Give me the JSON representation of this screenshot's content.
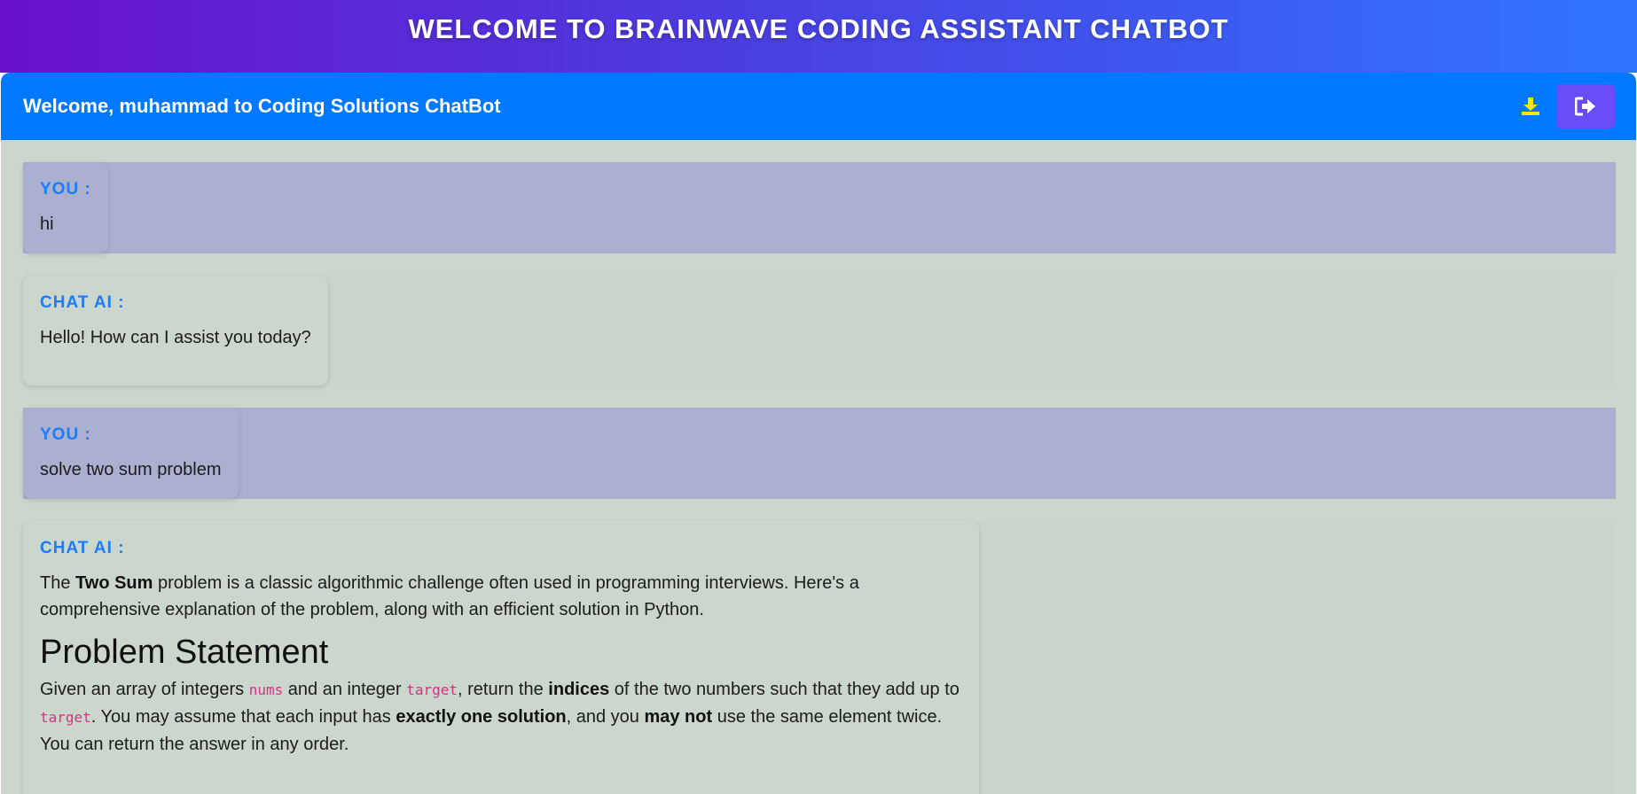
{
  "banner": {
    "title": "WELCOME TO BRAINWAVE CODING ASSISTANT CHATBOT"
  },
  "header": {
    "title": "Welcome, muhammad to Coding Solutions ChatBot",
    "download_icon": "download-icon",
    "logout_icon": "sign-out-icon"
  },
  "colors": {
    "banner_gradient_start": "#6a11cb",
    "banner_gradient_end": "#2f75ff",
    "header_bg": "#0078ff",
    "panel_bg": "#cbd6cc",
    "user_row_bg": "#abafd0",
    "sender_label": "#1a7cff",
    "logout_button": "#6a4cf6",
    "download_icon": "#ffe600",
    "code_text": "#d63384"
  },
  "messages": [
    {
      "sender": "YOU :",
      "text": "hi"
    },
    {
      "sender": "CHAT AI :",
      "text": "Hello! How can I assist you today?"
    },
    {
      "sender": "YOU :",
      "text": "solve two sum problem"
    },
    {
      "sender": "CHAT AI :",
      "intro": {
        "t1": "The ",
        "b1": "Two Sum",
        "t2": " problem is a classic algorithmic challenge often used in programming interviews. Here's a comprehensive explanation of the problem, along with an efficient solution in Python."
      },
      "heading": "Problem Statement",
      "statement": {
        "t1": "Given an array of integers ",
        "c1": "nums",
        "t2": " and an integer ",
        "c2": "target",
        "t3": ", return the ",
        "b1": "indices",
        "t4": " of the two numbers such that they add up to ",
        "c3": "target",
        "t5": ". You may assume that each input has ",
        "b2": "exactly one solution",
        "t6": ", and you ",
        "b3": "may not",
        "t7": " use the same element twice. You can return the answer in any order."
      }
    }
  ]
}
